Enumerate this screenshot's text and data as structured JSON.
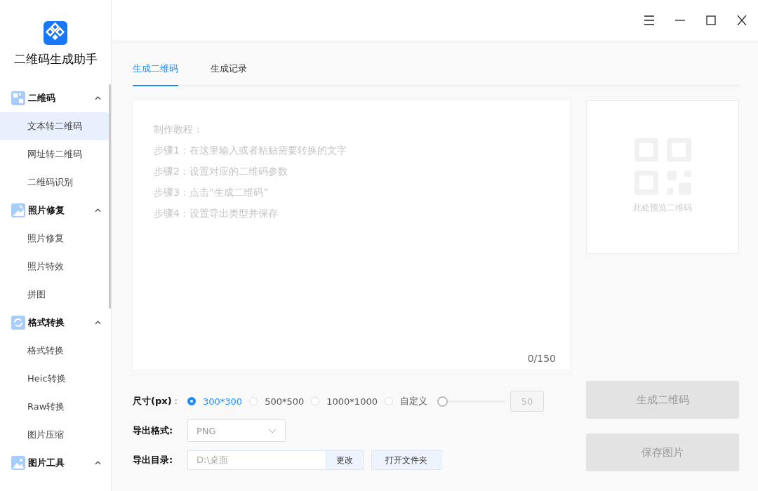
{
  "app": {
    "title": "二维码生成助手"
  },
  "sidebar": {
    "groups": [
      {
        "label": "二维码",
        "kind": "qr",
        "expanded": true,
        "items": [
          {
            "label": "文本转二维码",
            "selected": true
          },
          {
            "label": "网址转二维码",
            "selected": false
          },
          {
            "label": "二维码识别",
            "selected": false
          }
        ]
      },
      {
        "label": "照片修复",
        "kind": "photo-fix",
        "expanded": true,
        "items": [
          {
            "label": "照片修复",
            "selected": false
          },
          {
            "label": "照片特效",
            "selected": false
          },
          {
            "label": "拼图",
            "selected": false
          }
        ]
      },
      {
        "label": "格式转换",
        "kind": "convert",
        "expanded": true,
        "items": [
          {
            "label": "格式转换",
            "selected": false
          },
          {
            "label": "Heic转换",
            "selected": false
          },
          {
            "label": "Raw转换",
            "selected": false
          },
          {
            "label": "图片压缩",
            "selected": false
          }
        ]
      },
      {
        "label": "图片工具",
        "kind": "image",
        "expanded": true
      }
    ]
  },
  "tabs": [
    {
      "label": "生成二维码",
      "selected": true
    },
    {
      "label": "生成记录",
      "selected": false
    }
  ],
  "editor": {
    "placeholder_lines": [
      "制作教程：",
      "步骤1：在这里输入或者粘贴需要转换的文字",
      "步骤2：设置对应的二维码参数",
      "步骤3：点击“生成二维码”",
      "步骤4：设置导出类型并保存"
    ],
    "counter": "0/150"
  },
  "preview": {
    "caption": "此处预览二维码"
  },
  "size": {
    "label": "尺寸(px)",
    "colon": ":",
    "options": [
      {
        "label": "300*300",
        "selected": true
      },
      {
        "label": "500*500",
        "selected": false
      },
      {
        "label": "1000*1000",
        "selected": false
      },
      {
        "label": "自定义",
        "selected": false
      }
    ],
    "slider": {
      "level": 0
    },
    "value": "50"
  },
  "format": {
    "label": "导出格式:",
    "value": "PNG"
  },
  "directory": {
    "label": "导出目录:",
    "value": "D:\\桌面",
    "change_button": "更改",
    "open_button": "打开文件夹"
  },
  "buttons": [
    {
      "label": "生成二维码",
      "disabled": true
    },
    {
      "label": "保存图片",
      "disabled": true
    }
  ]
}
